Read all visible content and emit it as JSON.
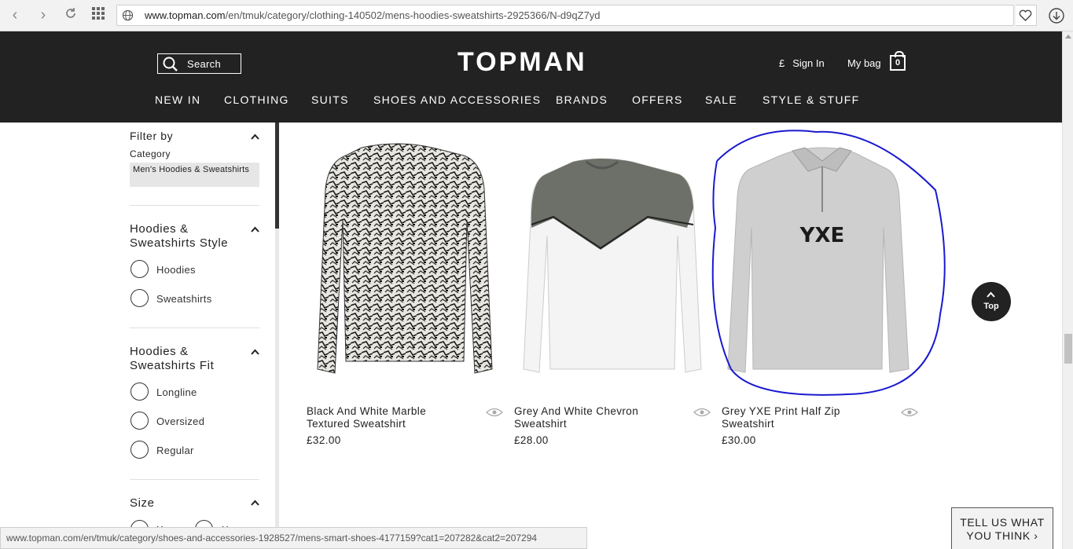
{
  "browser": {
    "url_host": "www.topman.com",
    "url_path": "/en/tmuk/category/clothing-140502/mens-hoodies-sweatshirts-2925366/N-d9qZ7yd",
    "status_url": "www.topman.com/en/tmuk/category/shoes-and-accessories-1928527/mens-smart-shoes-4177159?cat1=207282&cat2=207294"
  },
  "header": {
    "search_label": "Search",
    "logo": "TOPMAN",
    "currency": "£",
    "sign_in": "Sign In",
    "my_bag": "My bag",
    "bag_count": "0"
  },
  "nav": [
    "NEW IN",
    "CLOTHING",
    "SUITS",
    "SHOES AND ACCESSORIES",
    "BRANDS",
    "OFFERS",
    "SALE",
    "STYLE & STUFF"
  ],
  "filter": {
    "title": "Filter by",
    "category_label": "Category",
    "category_value": "Men's Hoodies & Sweatshirts",
    "style_group": {
      "title": "Hoodies & Sweatshirts Style",
      "options": [
        "Hoodies",
        "Sweatshirts"
      ]
    },
    "fit_group": {
      "title": "Hoodies & Sweatshirts Fit",
      "options": [
        "Longline",
        "Oversized",
        "Regular"
      ]
    },
    "size_group": {
      "title": "Size",
      "options": [
        "Xxs",
        "Xs"
      ]
    }
  },
  "products": [
    {
      "name": "Black And White Marble Textured Sweatshirt",
      "price": "£32.00"
    },
    {
      "name": "Grey And White Chevron Sweatshirt",
      "price": "£28.00"
    },
    {
      "name": "Grey YXE Print Half Zip Sweatshirt",
      "price": "£30.00",
      "print_text": "YXE"
    }
  ],
  "top_button": "Top",
  "feedback": "TELL US WHAT YOU THINK ›",
  "colors": {
    "header_bg": "#222222",
    "annotation": "#1a1ad0"
  }
}
